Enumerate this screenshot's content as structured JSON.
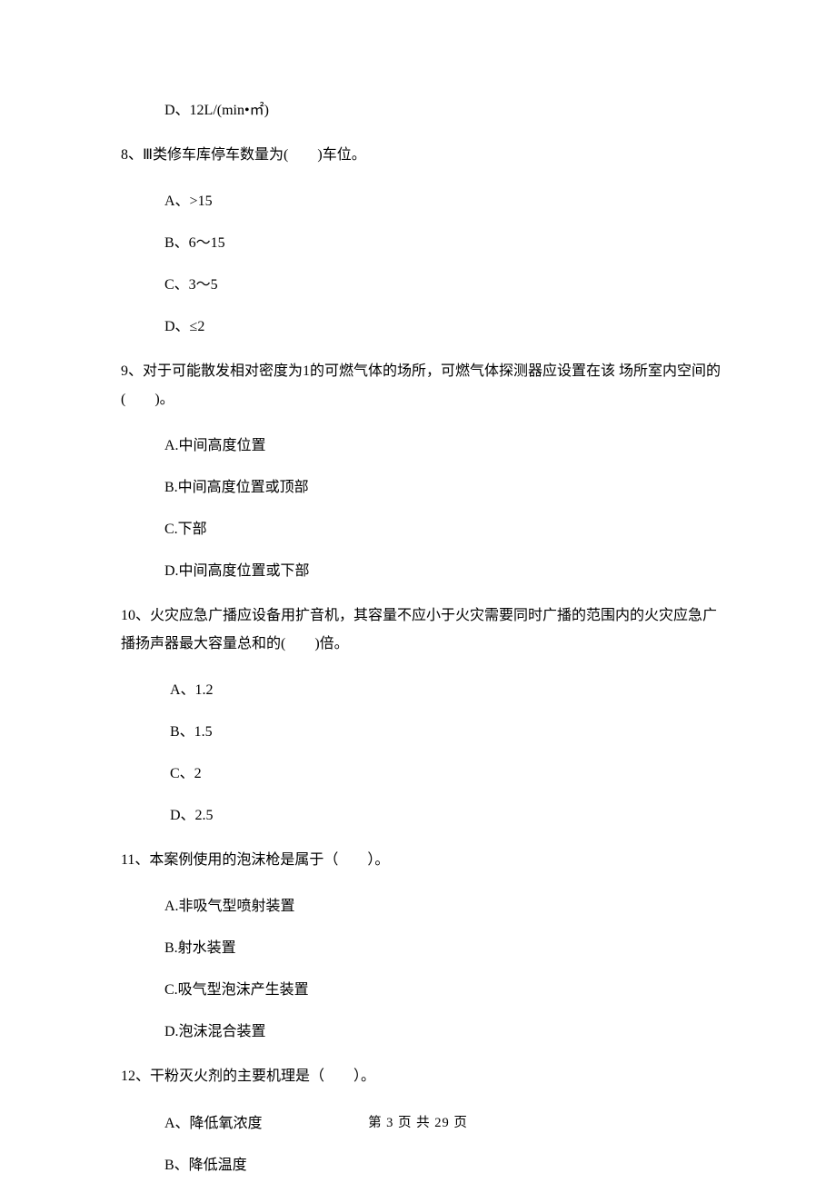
{
  "q7": {
    "optD": "D、12L/(min•㎡)"
  },
  "q8": {
    "stem": "8、Ⅲ类修车库停车数量为(　　)车位。",
    "optA": "A、>15",
    "optB": "B、6～15",
    "optC": "C、3～5",
    "optD": "D、≤2"
  },
  "q9": {
    "stem": "9、对于可能散发相对密度为1的可燃气体的场所，可燃气体探测器应设置在该 场所室内空间的(　　)。",
    "optA": "A.中间高度位置",
    "optB": "B.中间高度位置或顶部",
    "optC": "C.下部",
    "optD": "D.中间高度位置或下部"
  },
  "q10": {
    "stem": "10、火灾应急广播应设备用扩音机，其容量不应小于火灾需要同时广播的范围内的火灾应急广播扬声器最大容量总和的(　　)倍。",
    "optA": "A、1.2",
    "optB": "B、1.5",
    "optC": "C、2",
    "optD": "D、2.5"
  },
  "q11": {
    "stem": "11、本案例使用的泡沫枪是属于（　　）。",
    "optA": "A.非吸气型喷射装置",
    "optB": "B.射水装置",
    "optC": "C.吸气型泡沫产生装置",
    "optD": "D.泡沫混合装置"
  },
  "q12": {
    "stem": "12、干粉灭火剂的主要机理是（　　）。",
    "optA": "A、降低氧浓度",
    "optB": "B、降低温度"
  },
  "footer": "第 3 页 共 29 页"
}
